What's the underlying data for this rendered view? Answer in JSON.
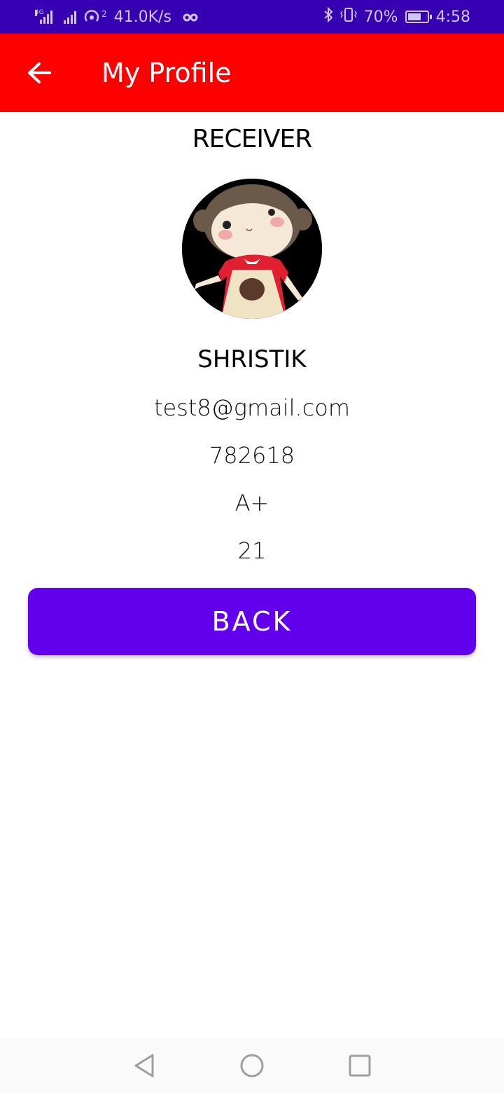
{
  "status_bar": {
    "network_label": "4G",
    "speed": "41.0K/s",
    "hotspot_count": "2",
    "battery_percent": "70%",
    "battery_level": 0.7,
    "time": "4:58"
  },
  "app_bar": {
    "title": "My Profile",
    "color": "#ff0000"
  },
  "profile": {
    "role": "RECEIVER",
    "name": "SHRISTIK",
    "email": "test8@gmail.com",
    "phone": "782618",
    "blood_group": "A+",
    "age": "21"
  },
  "actions": {
    "back_label": "BACK",
    "accent": "#6200ee"
  }
}
